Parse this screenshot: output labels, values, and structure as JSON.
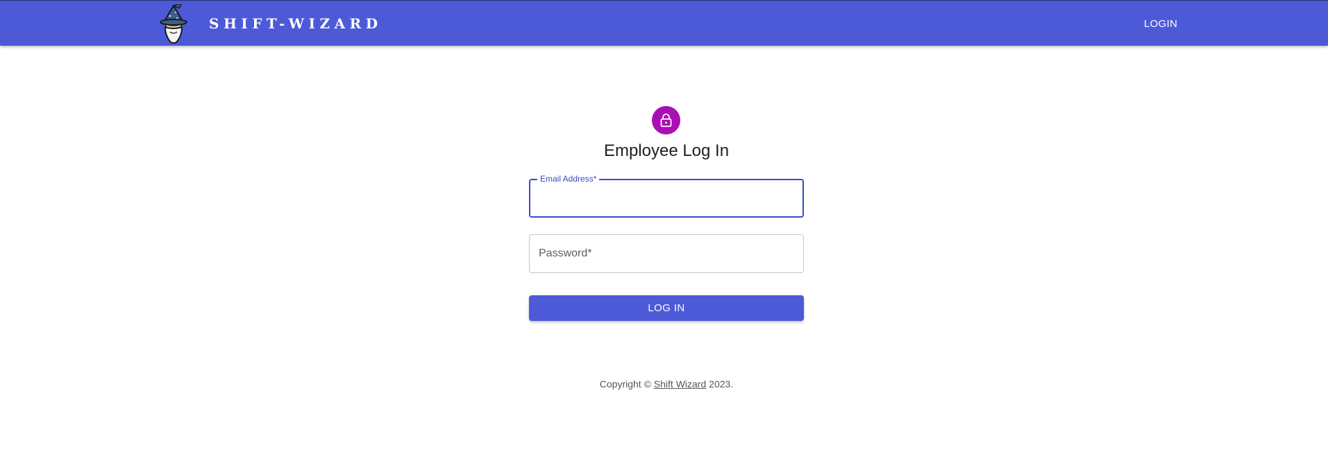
{
  "header": {
    "brand": "SHIFT-WIZARD",
    "logo_icon": "wizard-logo-icon",
    "nav_login_label": "LOGIN",
    "color": "#4d5ad8"
  },
  "login": {
    "icon": "lock-icon",
    "icon_color": "#a90fb5",
    "title": "Employee Log In",
    "email": {
      "label": "Email Address",
      "required_mark": "*",
      "value": ""
    },
    "password": {
      "label": "Password",
      "required_mark": "*",
      "value": ""
    },
    "submit_label": "LOG IN"
  },
  "footer": {
    "prefix": "Copyright © ",
    "link_text": "Shift Wizard",
    "suffix": " 2023."
  }
}
